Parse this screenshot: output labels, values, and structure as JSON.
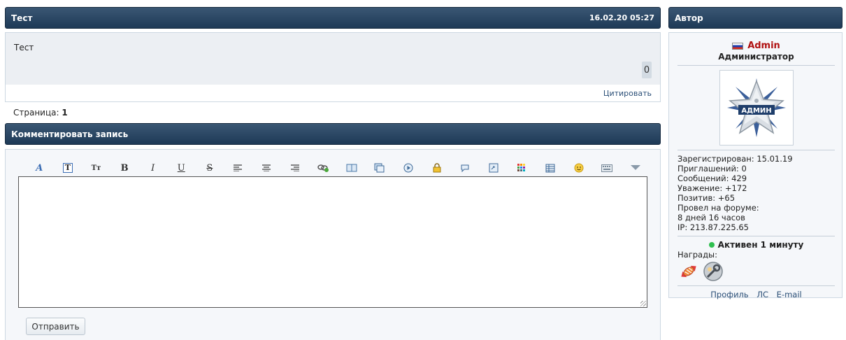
{
  "post": {
    "title": "Тест",
    "datetime": "16.02.20 05:27",
    "text": "Тест",
    "likes": "0",
    "quote_label": "Цитировать"
  },
  "pagination": {
    "label": "Страница:",
    "current": "1"
  },
  "comment": {
    "header": "Комментировать запись",
    "toolbar": [
      "font",
      "font-color",
      "font-size",
      "bold",
      "italic",
      "underline",
      "strike",
      "align-left",
      "align-center",
      "align-right",
      "link",
      "image-library",
      "gallery",
      "video",
      "hide",
      "spoiler",
      "code",
      "color-picker",
      "table",
      "smilies",
      "keyboard",
      "more"
    ],
    "submit_label": "Отправить"
  },
  "author": {
    "header": "Автор",
    "name": "Admin",
    "role": "Администратор",
    "avatar_text": "АДМИН",
    "registered": "Зарегистрирован: 15.01.19",
    "invites": "Приглашений: 0",
    "messages": "Сообщений: 429",
    "respect": "Уважение: +172",
    "positive": "Позитив: +65",
    "time_on_forum_label": "Провел на форуме:",
    "time_on_forum": "8 дней 16 часов",
    "ip": "IP: 213.87.225.65",
    "active": "Активен 1 минуту",
    "awards_label": "Награды:",
    "links": [
      "Профиль",
      "ЛС",
      "E-mail"
    ],
    "status_color": "#2fbf4f",
    "name_color": "#b01010"
  }
}
